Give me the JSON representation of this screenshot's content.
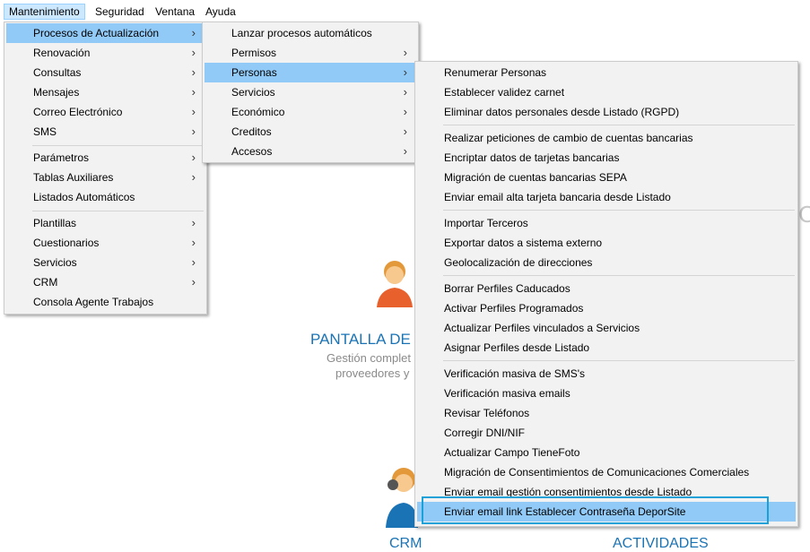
{
  "menubar": {
    "items": [
      {
        "label": "Mantenimiento"
      },
      {
        "label": "Seguridad"
      },
      {
        "label": "Ventana"
      },
      {
        "label": "Ayuda"
      }
    ]
  },
  "background": {
    "title_fragment": "PANTALLA DE",
    "desc_line1": "Gestión complet",
    "desc_line2": "proveedores y",
    "bottom_left": "CRM",
    "bottom_right": "ACTIVIDADES",
    "edge_letter": "C"
  },
  "menu_main": {
    "items": [
      {
        "label": "Procesos de Actualización",
        "submenu": true
      },
      {
        "label": "Renovación",
        "submenu": true
      },
      {
        "label": "Consultas",
        "submenu": true
      },
      {
        "label": "Mensajes",
        "submenu": true
      },
      {
        "label": "Correo Electrónico",
        "submenu": true
      },
      {
        "label": "SMS",
        "submenu": true
      },
      {
        "label": "Parámetros",
        "submenu": true
      },
      {
        "label": "Tablas Auxiliares",
        "submenu": true
      },
      {
        "label": "Listados Automáticos",
        "submenu": false
      },
      {
        "label": "Plantillas",
        "submenu": true
      },
      {
        "label": "Cuestionarios",
        "submenu": true
      },
      {
        "label": "Servicios",
        "submenu": true
      },
      {
        "label": "CRM",
        "submenu": true
      },
      {
        "label": "Consola Agente Trabajos",
        "submenu": false
      }
    ]
  },
  "menu_procesos": {
    "items": [
      {
        "label": "Lanzar procesos automáticos",
        "submenu": false
      },
      {
        "label": "Permisos",
        "submenu": true
      },
      {
        "label": "Personas",
        "submenu": true
      },
      {
        "label": "Servicios",
        "submenu": true
      },
      {
        "label": "Económico",
        "submenu": true
      },
      {
        "label": "Creditos",
        "submenu": true
      },
      {
        "label": "Accesos",
        "submenu": true
      }
    ]
  },
  "menu_personas": {
    "items": [
      {
        "label": "Renumerar Personas"
      },
      {
        "label": "Establecer validez carnet"
      },
      {
        "label": "Eliminar datos personales desde Listado (RGPD)"
      },
      {
        "label": "Realizar peticiones de cambio de cuentas bancarias"
      },
      {
        "label": "Encriptar datos de tarjetas bancarias"
      },
      {
        "label": "Migración de cuentas bancarias SEPA"
      },
      {
        "label": "Enviar email alta tarjeta bancaria desde Listado"
      },
      {
        "label": "Importar Terceros"
      },
      {
        "label": "Exportar datos a sistema externo"
      },
      {
        "label": "Geolocalización de direcciones"
      },
      {
        "label": "Borrar Perfiles Caducados"
      },
      {
        "label": "Activar Perfiles Programados"
      },
      {
        "label": "Actualizar Perfiles vinculados a Servicios"
      },
      {
        "label": "Asignar Perfiles desde Listado"
      },
      {
        "label": "Verificación masiva de SMS's"
      },
      {
        "label": "Verificación masiva emails"
      },
      {
        "label": "Revisar Teléfonos"
      },
      {
        "label": "Corregir DNI/NIF"
      },
      {
        "label": "Actualizar Campo TieneFoto"
      },
      {
        "label": "Migración de Consentimientos de Comunicaciones Comerciales"
      },
      {
        "label": "Enviar email gestión consentimientos desde Listado"
      },
      {
        "label": "Enviar email link Establecer Contraseña DeporSite"
      }
    ]
  },
  "icons": {
    "submenu_arrow": "›"
  },
  "colors": {
    "highlight": "#91c9f7",
    "focus_border": "#19a1d8",
    "accent_text": "#1a73b5"
  }
}
